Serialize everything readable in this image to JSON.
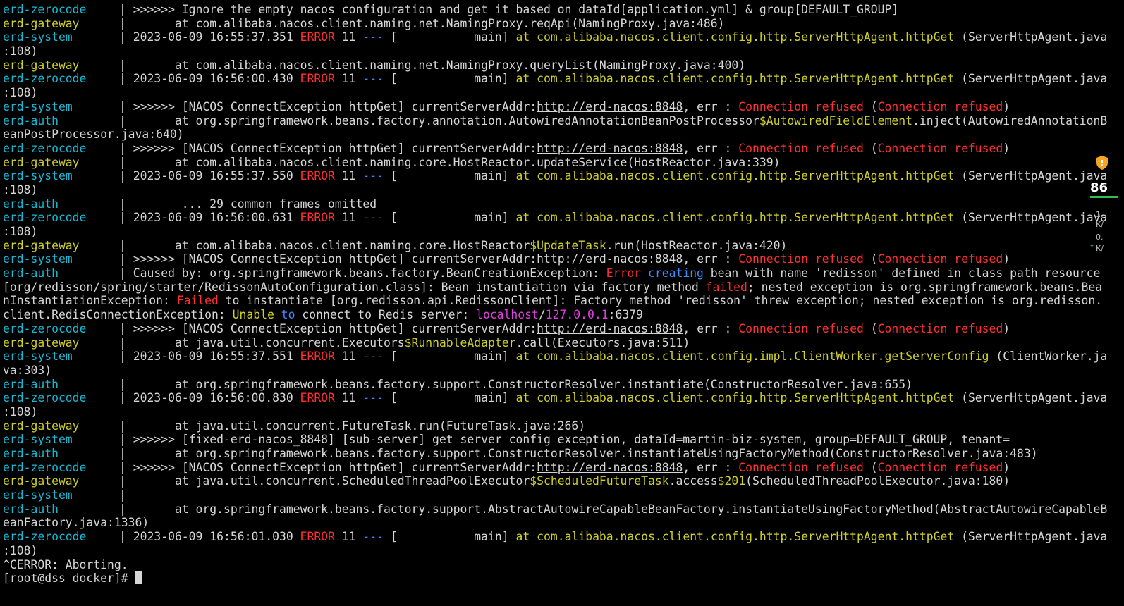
{
  "colors": {
    "background": "#000000",
    "text": "#d6d6d6",
    "service_cyan": "#17b8d4",
    "service_yellow": "#cfcf2a",
    "error_red": "#ff2f2f",
    "class_yellow": "#cfcf2a",
    "keyword_blue": "#3f8cff",
    "host_magenta": "#e13ee1"
  },
  "terminal": {
    "lines": [
      {
        "segments": [
          {
            "t": "erd-zerocode",
            "c": "cyan",
            "svc": true
          },
          {
            "t": "| >>>>>> Ignore the empty nacos configuration and get it based on dataId[application.yml] & group[DEFAULT_GROUP]"
          }
        ]
      },
      {
        "segments": [
          {
            "t": "erd-gateway",
            "c": "yellow",
            "svc": true
          },
          {
            "t": "|       at com.alibaba.nacos.client.naming.net.NamingProxy.reqApi(NamingProxy.java:486)"
          }
        ]
      },
      {
        "segments": [
          {
            "t": "erd-system",
            "c": "cyan",
            "svc": true
          },
          {
            "t": "| 2023-06-09 16:55:37.351 "
          },
          {
            "t": "ERROR",
            "c": "red"
          },
          {
            "t": " 11 "
          },
          {
            "t": "---",
            "c": "blue"
          },
          {
            "t": " [           main] "
          },
          {
            "t": "at com.alibaba.nacos.client.config.http.ServerHttpAgent.httpGet",
            "c": "yellow"
          },
          {
            "t": " (ServerHttpAgent.java"
          }
        ]
      },
      {
        "segments": [
          {
            "t": ":108)"
          }
        ]
      },
      {
        "segments": [
          {
            "t": "erd-gateway",
            "c": "yellow",
            "svc": true
          },
          {
            "t": "|       at com.alibaba.nacos.client.naming.net.NamingProxy.queryList(NamingProxy.java:400)"
          }
        ]
      },
      {
        "segments": [
          {
            "t": "erd-zerocode",
            "c": "cyan",
            "svc": true
          },
          {
            "t": "| 2023-06-09 16:56:00.430 "
          },
          {
            "t": "ERROR",
            "c": "red"
          },
          {
            "t": " 11 "
          },
          {
            "t": "---",
            "c": "blue"
          },
          {
            "t": " [           main] "
          },
          {
            "t": "at com.alibaba.nacos.client.config.http.ServerHttpAgent.httpGet",
            "c": "yellow"
          },
          {
            "t": " (ServerHttpAgent.java"
          }
        ]
      },
      {
        "segments": [
          {
            "t": ":108)"
          }
        ]
      },
      {
        "segments": [
          {
            "t": "erd-system",
            "c": "cyan",
            "svc": true
          },
          {
            "t": "| >>>>>> [NACOS ConnectException httpGet] currentServerAddr:"
          },
          {
            "t": "http://erd-nacos:8848",
            "u": true
          },
          {
            "t": ", err : "
          },
          {
            "t": "Connection refused",
            "c": "red"
          },
          {
            "t": " ("
          },
          {
            "t": "Connection refused",
            "c": "red"
          },
          {
            "t": ")"
          }
        ]
      },
      {
        "segments": [
          {
            "t": "erd-auth",
            "c": "cyan",
            "svc": true
          },
          {
            "t": "|       at org.springframework.beans.factory.annotation.AutowiredAnnotationBeanPostProcessor"
          },
          {
            "t": "$AutowiredFieldElement",
            "c": "yellow"
          },
          {
            "t": ".inject(AutowiredAnnotationB"
          }
        ]
      },
      {
        "segments": [
          {
            "t": "eanPostProcessor.java:640)"
          }
        ]
      },
      {
        "segments": [
          {
            "t": "erd-zerocode",
            "c": "cyan",
            "svc": true
          },
          {
            "t": "| >>>>>> [NACOS ConnectException httpGet] currentServerAddr:"
          },
          {
            "t": "http://erd-nacos:8848",
            "u": true
          },
          {
            "t": ", err : "
          },
          {
            "t": "Connection refused",
            "c": "red"
          },
          {
            "t": " ("
          },
          {
            "t": "Connection refused",
            "c": "red"
          },
          {
            "t": ")"
          }
        ]
      },
      {
        "segments": [
          {
            "t": "erd-gateway",
            "c": "yellow",
            "svc": true
          },
          {
            "t": "|       at com.alibaba.nacos.client.naming.core.HostReactor.updateService(HostReactor.java:339)"
          }
        ]
      },
      {
        "segments": [
          {
            "t": "erd-system",
            "c": "cyan",
            "svc": true
          },
          {
            "t": "| 2023-06-09 16:55:37.550 "
          },
          {
            "t": "ERROR",
            "c": "red"
          },
          {
            "t": " 11 "
          },
          {
            "t": "---",
            "c": "blue"
          },
          {
            "t": " [           main] "
          },
          {
            "t": "at com.alibaba.nacos.client.config.http.ServerHttpAgent.httpGet",
            "c": "yellow"
          },
          {
            "t": " (ServerHttpAgent.java"
          }
        ]
      },
      {
        "segments": [
          {
            "t": ":108)"
          }
        ]
      },
      {
        "segments": [
          {
            "t": "erd-auth",
            "c": "cyan",
            "svc": true
          },
          {
            "t": "|        ... 29 common frames omitted"
          }
        ]
      },
      {
        "segments": [
          {
            "t": "erd-zerocode",
            "c": "cyan",
            "svc": true
          },
          {
            "t": "| 2023-06-09 16:56:00.631 "
          },
          {
            "t": "ERROR",
            "c": "red"
          },
          {
            "t": " 11 "
          },
          {
            "t": "---",
            "c": "blue"
          },
          {
            "t": " [           main] "
          },
          {
            "t": "at com.alibaba.nacos.client.config.http.ServerHttpAgent.httpGet",
            "c": "yellow"
          },
          {
            "t": " (ServerHttpAgent.java"
          }
        ]
      },
      {
        "segments": [
          {
            "t": ":108)"
          }
        ]
      },
      {
        "segments": [
          {
            "t": "erd-gateway",
            "c": "yellow",
            "svc": true
          },
          {
            "t": "|       at com.alibaba.nacos.client.naming.core.HostReactor"
          },
          {
            "t": "$UpdateTask",
            "c": "yellow"
          },
          {
            "t": ".run(HostReactor.java:420)"
          }
        ]
      },
      {
        "segments": [
          {
            "t": "erd-system",
            "c": "cyan",
            "svc": true
          },
          {
            "t": "| >>>>>> [NACOS ConnectException httpGet] currentServerAddr:"
          },
          {
            "t": "http://erd-nacos:8848",
            "u": true
          },
          {
            "t": ", err : "
          },
          {
            "t": "Connection refused",
            "c": "red"
          },
          {
            "t": " ("
          },
          {
            "t": "Connection refused",
            "c": "red"
          },
          {
            "t": ")"
          }
        ]
      },
      {
        "segments": [
          {
            "t": "erd-auth",
            "c": "cyan",
            "svc": true
          },
          {
            "t": "| Caused by: org.springframework.beans.factory.BeanCreationException: "
          },
          {
            "t": "Error",
            "c": "red"
          },
          {
            "t": " "
          },
          {
            "t": "creating",
            "c": "blue"
          },
          {
            "t": " bean with name 'redisson' defined in class path resource"
          }
        ]
      },
      {
        "segments": [
          {
            "t": "[org/redisson/spring/starter/RedissonAutoConfiguration.class]: Bean instantiation via factory method "
          },
          {
            "t": "failed",
            "c": "red"
          },
          {
            "t": "; nested exception is org.springframework.beans.Bea"
          }
        ]
      },
      {
        "segments": [
          {
            "t": "nInstantiationException: "
          },
          {
            "t": "Failed",
            "c": "red"
          },
          {
            "t": " to instantiate [org.redisson.api.RedissonClient]: Factory method 'redisson' threw exception; nested exception is org.redisson."
          }
        ]
      },
      {
        "segments": [
          {
            "t": "client.RedisConnectionException: "
          },
          {
            "t": "Unable",
            "c": "yellow"
          },
          {
            "t": " "
          },
          {
            "t": "to",
            "c": "blue"
          },
          {
            "t": " connect to Redis server: "
          },
          {
            "t": "localhost",
            "c": "magenta"
          },
          {
            "t": "/"
          },
          {
            "t": "127.0.0.1",
            "c": "magenta"
          },
          {
            "t": ":6379"
          }
        ]
      },
      {
        "segments": [
          {
            "t": "erd-zerocode",
            "c": "cyan",
            "svc": true
          },
          {
            "t": "| >>>>>> [NACOS ConnectException httpGet] currentServerAddr:"
          },
          {
            "t": "http://erd-nacos:8848",
            "u": true
          },
          {
            "t": ", err : "
          },
          {
            "t": "Connection refused",
            "c": "red"
          },
          {
            "t": " ("
          },
          {
            "t": "Connection refused",
            "c": "red"
          },
          {
            "t": ")"
          }
        ]
      },
      {
        "segments": [
          {
            "t": "erd-gateway",
            "c": "yellow",
            "svc": true
          },
          {
            "t": "|       at java.util.concurrent.Executors"
          },
          {
            "t": "$RunnableAdapter",
            "c": "yellow"
          },
          {
            "t": ".call(Executors.java:511)"
          }
        ]
      },
      {
        "segments": [
          {
            "t": "erd-system",
            "c": "cyan",
            "svc": true
          },
          {
            "t": "| 2023-06-09 16:55:37.551 "
          },
          {
            "t": "ERROR",
            "c": "red"
          },
          {
            "t": " 11 "
          },
          {
            "t": "---",
            "c": "blue"
          },
          {
            "t": " [           main] "
          },
          {
            "t": "at com.alibaba.nacos.client.config.impl.ClientWorker.getServerConfig",
            "c": "yellow"
          },
          {
            "t": " (ClientWorker.ja"
          }
        ]
      },
      {
        "segments": [
          {
            "t": "va:303)"
          }
        ]
      },
      {
        "segments": [
          {
            "t": "erd-auth",
            "c": "cyan",
            "svc": true
          },
          {
            "t": "|       at org.springframework.beans.factory.support.ConstructorResolver.instantiate(ConstructorResolver.java:655)"
          }
        ]
      },
      {
        "segments": [
          {
            "t": "erd-zerocode",
            "c": "cyan",
            "svc": true
          },
          {
            "t": "| 2023-06-09 16:56:00.830 "
          },
          {
            "t": "ERROR",
            "c": "red"
          },
          {
            "t": " 11 "
          },
          {
            "t": "---",
            "c": "blue"
          },
          {
            "t": " [           main] "
          },
          {
            "t": "at com.alibaba.nacos.client.config.http.ServerHttpAgent.httpGet",
            "c": "yellow"
          },
          {
            "t": " (ServerHttpAgent.java"
          }
        ]
      },
      {
        "segments": [
          {
            "t": ":108)"
          }
        ]
      },
      {
        "segments": [
          {
            "t": "erd-gateway",
            "c": "yellow",
            "svc": true
          },
          {
            "t": "|       at java.util.concurrent.FutureTask.run(FutureTask.java:266)"
          }
        ]
      },
      {
        "segments": [
          {
            "t": "erd-system",
            "c": "cyan",
            "svc": true
          },
          {
            "t": "| >>>>>> [fixed-erd-nacos_8848] [sub-server] get server config exception, dataId=martin-biz-system, group=DEFAULT_GROUP, tenant="
          }
        ]
      },
      {
        "segments": [
          {
            "t": "erd-auth",
            "c": "cyan",
            "svc": true
          },
          {
            "t": "|       at org.springframework.beans.factory.support.ConstructorResolver.instantiateUsingFactoryMethod(ConstructorResolver.java:483)"
          }
        ]
      },
      {
        "segments": [
          {
            "t": "erd-zerocode",
            "c": "cyan",
            "svc": true
          },
          {
            "t": "| >>>>>> [NACOS ConnectException httpGet] currentServerAddr:"
          },
          {
            "t": "http://erd-nacos:8848",
            "u": true
          },
          {
            "t": ", err : "
          },
          {
            "t": "Connection refused",
            "c": "red"
          },
          {
            "t": " ("
          },
          {
            "t": "Connection refused",
            "c": "red"
          },
          {
            "t": ")"
          }
        ]
      },
      {
        "segments": [
          {
            "t": "erd-gateway",
            "c": "yellow",
            "svc": true
          },
          {
            "t": "|       at java.util.concurrent.ScheduledThreadPoolExecutor"
          },
          {
            "t": "$ScheduledFutureTask",
            "c": "yellow"
          },
          {
            "t": ".access"
          },
          {
            "t": "$201",
            "c": "yellow"
          },
          {
            "t": "(ScheduledThreadPoolExecutor.java:180)"
          }
        ]
      },
      {
        "segments": [
          {
            "t": "erd-system",
            "c": "cyan",
            "svc": true
          },
          {
            "t": "|"
          }
        ]
      },
      {
        "segments": [
          {
            "t": "erd-auth",
            "c": "cyan",
            "svc": true
          },
          {
            "t": "|       at org.springframework.beans.factory.support.AbstractAutowireCapableBeanFactory.instantiateUsingFactoryMethod(AbstractAutowireCapableB"
          }
        ]
      },
      {
        "segments": [
          {
            "t": "eanFactory.java:1336)"
          }
        ]
      },
      {
        "segments": [
          {
            "t": "erd-zerocode",
            "c": "cyan",
            "svc": true
          },
          {
            "t": "| 2023-06-09 16:56:01.030 "
          },
          {
            "t": "ERROR",
            "c": "red"
          },
          {
            "t": " 11 "
          },
          {
            "t": "---",
            "c": "blue"
          },
          {
            "t": " [           main] "
          },
          {
            "t": "at com.alibaba.nacos.client.config.http.ServerHttpAgent.httpGet",
            "c": "yellow"
          },
          {
            "t": " (ServerHttpAgent.java"
          }
        ]
      },
      {
        "segments": [
          {
            "t": ":108)"
          }
        ]
      },
      {
        "segments": [
          {
            "t": "^CERROR: Aborting."
          }
        ]
      }
    ],
    "prompt": "[root@dss docker]# "
  },
  "widget": {
    "icon": "shield-icon",
    "value": "86",
    "speed_up": "1.",
    "speed_up_unit": "K/",
    "speed_down": "0.",
    "speed_down_unit": "K/",
    "down_arrow": "↓"
  }
}
